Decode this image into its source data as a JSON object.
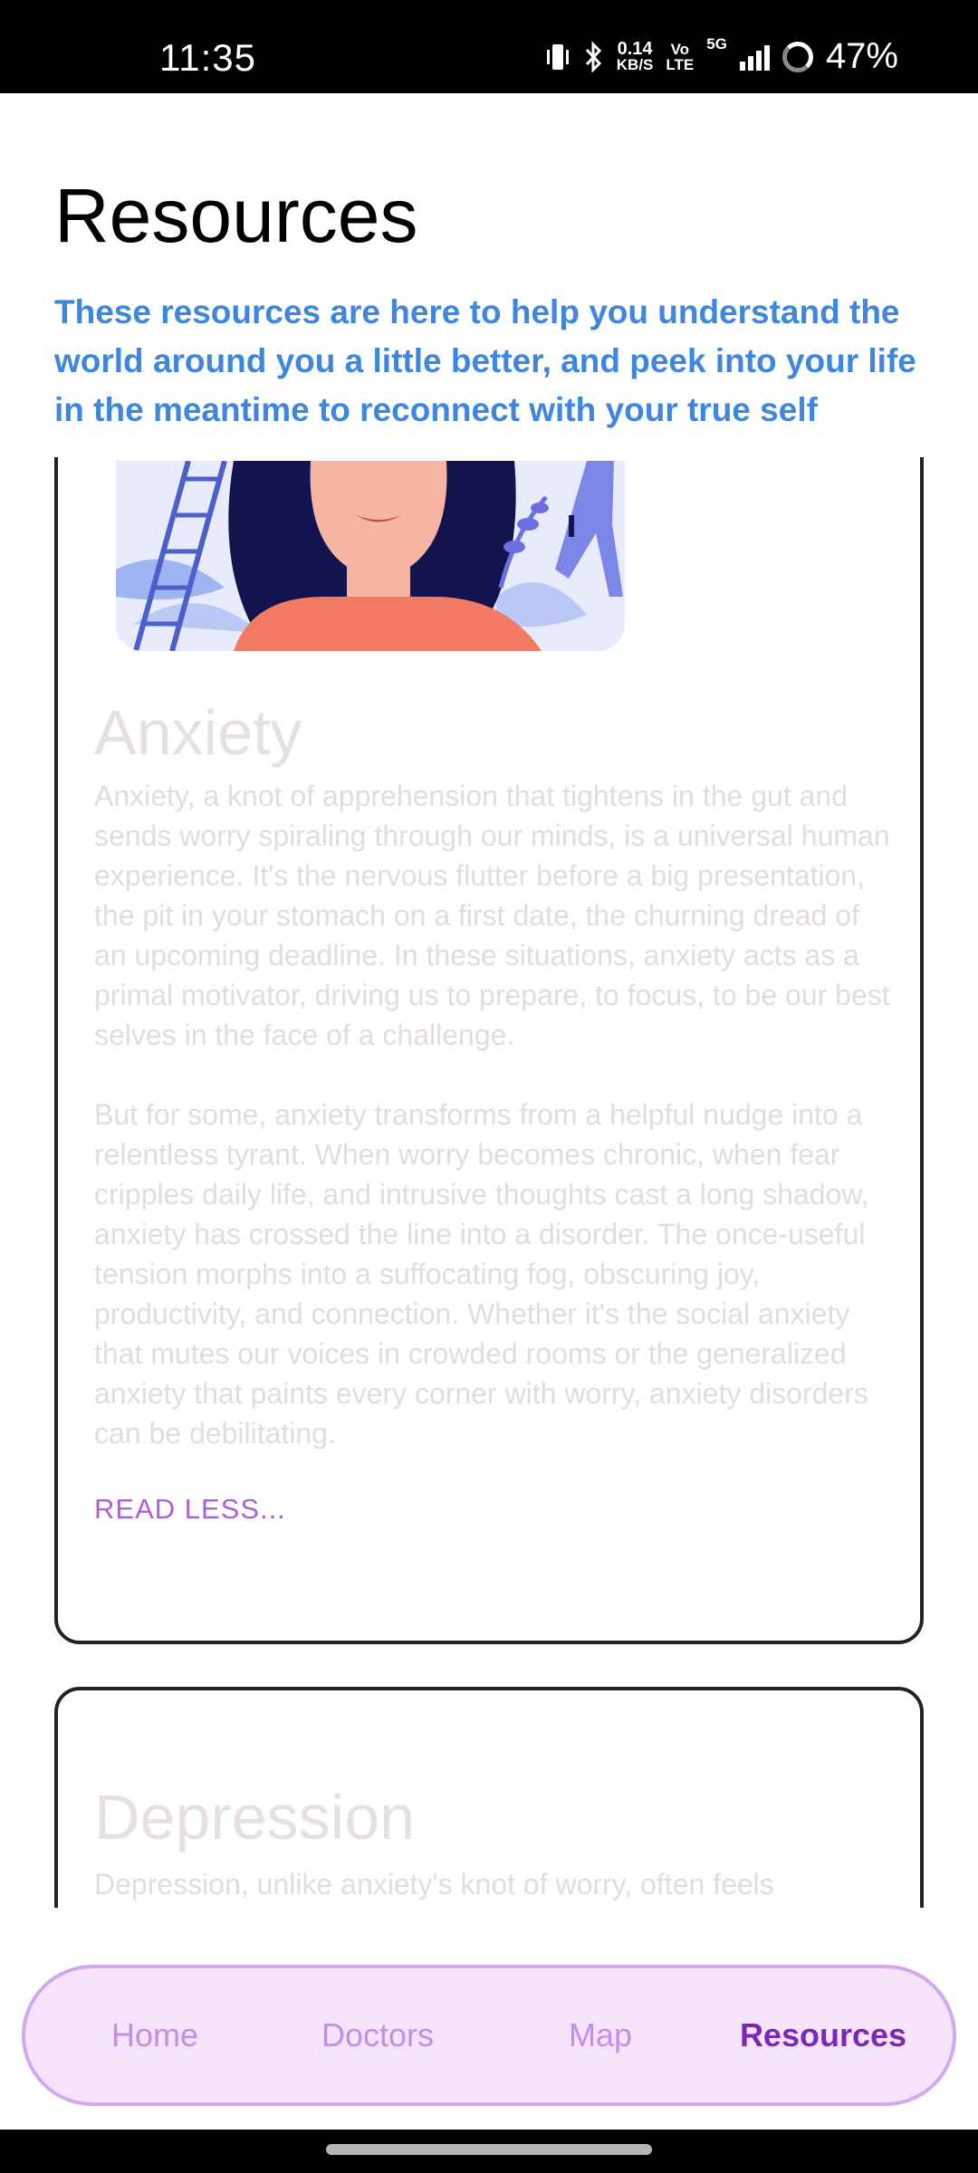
{
  "status_bar": {
    "time": "11:35",
    "net_speed_top": "0.14",
    "net_speed_bottom": "KB/S",
    "volte_top": "Vo",
    "volte_bottom": "LTE",
    "network": "5G",
    "battery": "47%"
  },
  "header": {
    "title": "Resources",
    "subtitle": "These resources are here to help you understand the world around you a little better, and peek into your life in the meantime to reconnect with your true self"
  },
  "cards": [
    {
      "title": "Anxiety",
      "paragraphs": [
        "Anxiety, a knot of apprehension that tightens in the gut and sends worry spiraling through our minds, is a universal human experience. It's the nervous flutter before a big presentation, the pit in your stomach on a first date, the churning dread of an upcoming deadline. In these situations, anxiety acts as a primal motivator, driving us to prepare, to focus, to be our best selves in the face of a challenge.",
        "But for some, anxiety transforms from a helpful nudge into a relentless tyrant. When worry becomes chronic, when fear cripples daily life, and intrusive thoughts cast a long shadow, anxiety has crossed the line into a disorder. The once-useful tension morphs into a suffocating fog, obscuring joy, productivity, and connection. Whether it's the social anxiety that mutes our voices in crowded rooms or the generalized anxiety that paints every corner with worry, anxiety disorders can be debilitating."
      ],
      "toggle_label": "READ LESS..."
    },
    {
      "title": "Depression",
      "paragraphs": [
        "Depression, unlike anxiety's knot of worry, often feels"
      ]
    }
  ],
  "bottom_nav": {
    "items": [
      "Home",
      "Doctors",
      "Map",
      "Resources"
    ],
    "active": "Resources"
  },
  "colors": {
    "subtitle": "#3f86df",
    "nav_active": "#7d27b8",
    "nav_inactive": "#c38ee5",
    "nav_bg": "#f4e3fb",
    "read_less": "#a95fd6"
  }
}
